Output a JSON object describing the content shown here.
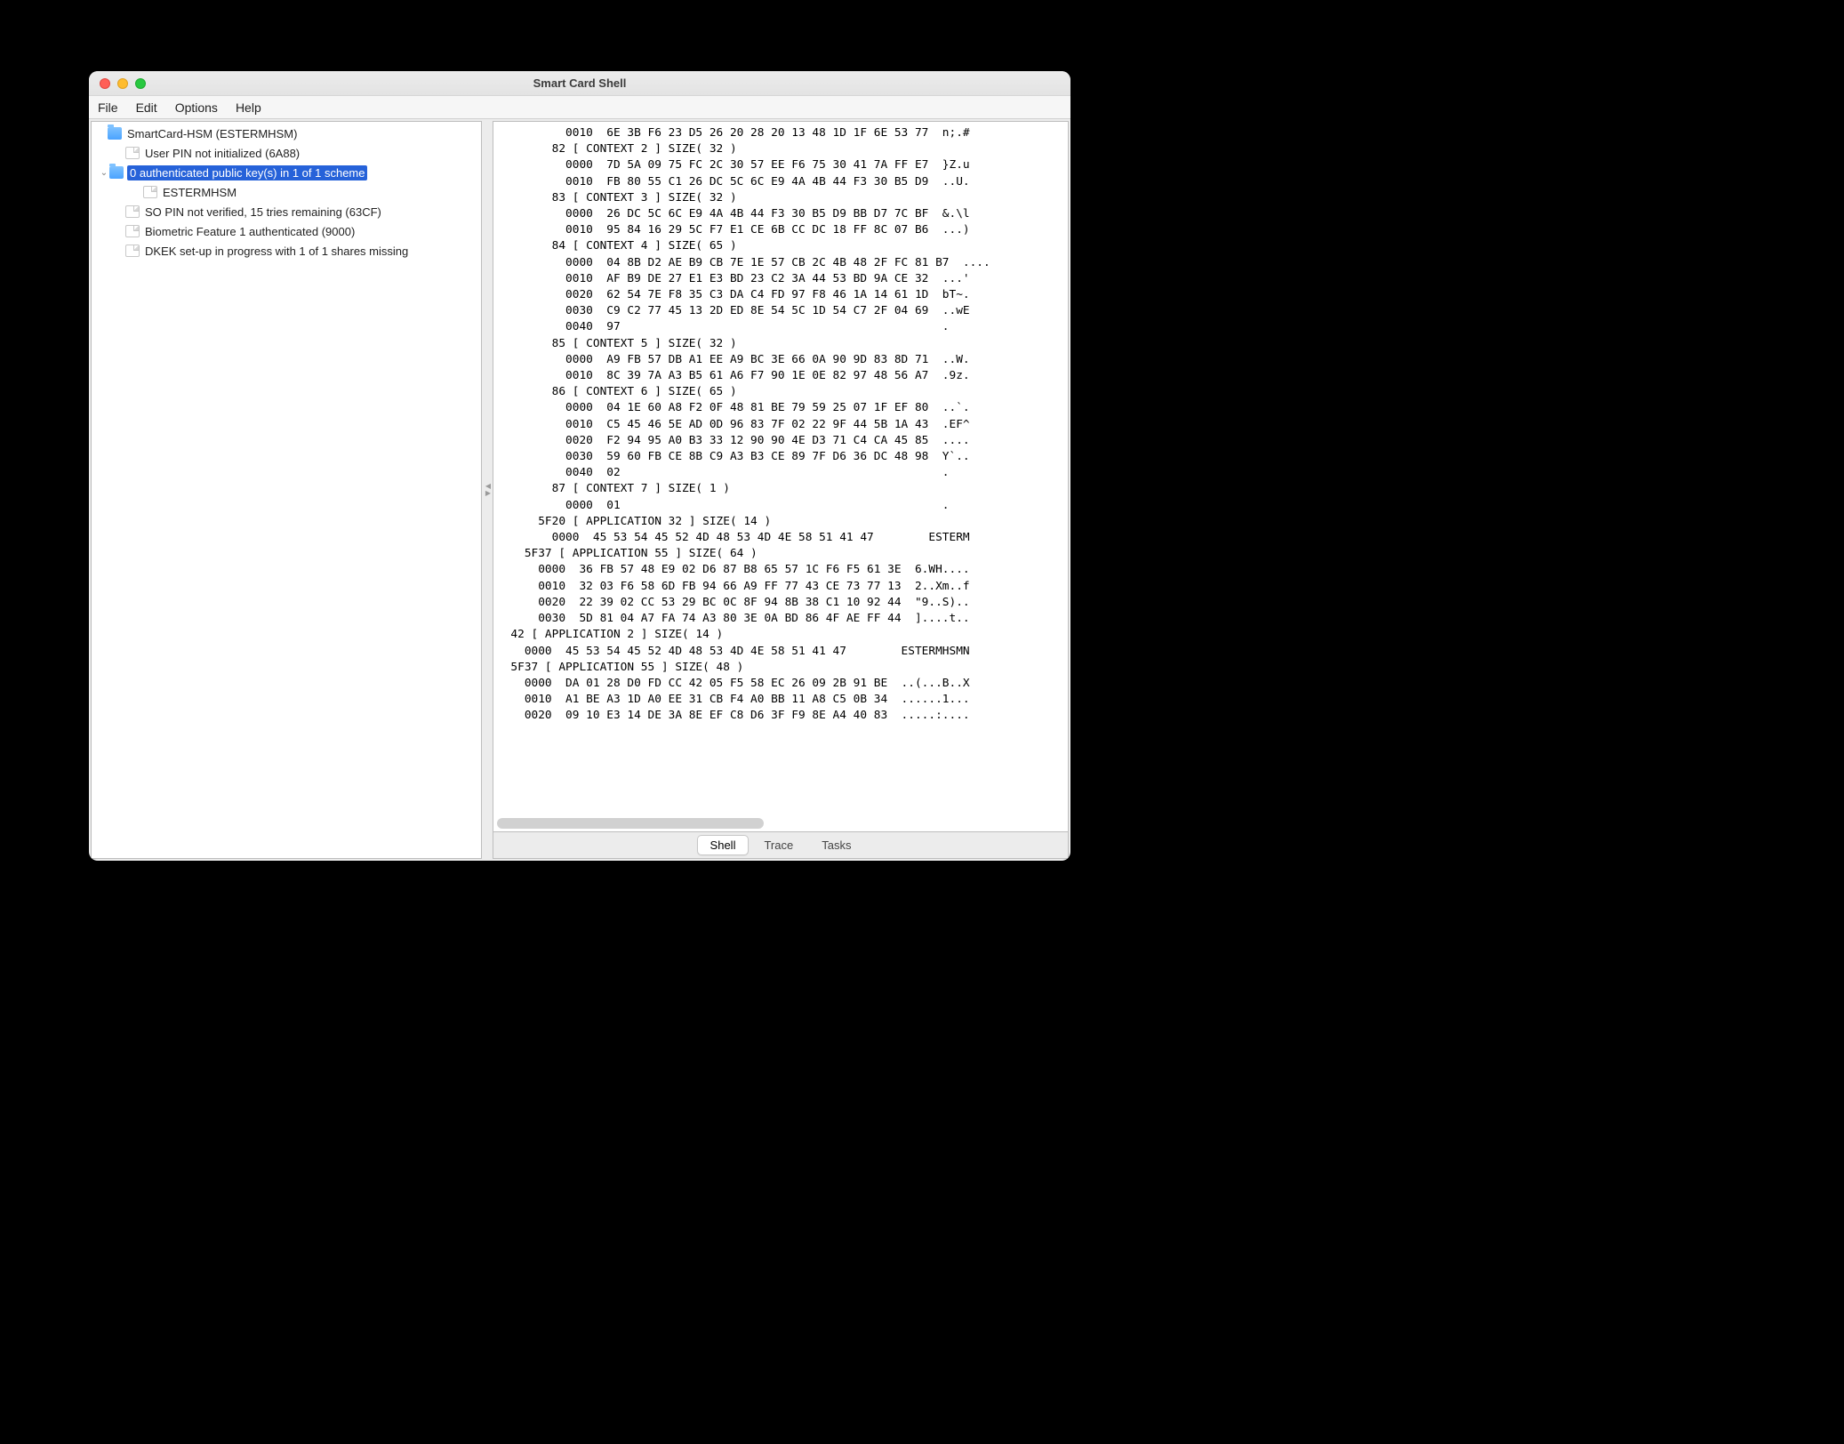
{
  "window": {
    "title": "Smart Card Shell"
  },
  "menu": {
    "items": [
      "File",
      "Edit",
      "Options",
      "Help"
    ]
  },
  "tree": {
    "root": {
      "label": "SmartCard-HSM (ESTERMHSM)",
      "children": [
        {
          "label": "User PIN not initialized (6A88)",
          "type": "file"
        },
        {
          "label": "0 authenticated public key(s) in 1 of 1 scheme",
          "type": "folder",
          "selected": true,
          "expanded": true,
          "children": [
            {
              "label": "ESTERMHSM",
              "type": "file"
            }
          ]
        },
        {
          "label": "SO PIN not verified, 15 tries remaining (63CF)",
          "type": "file"
        },
        {
          "label": "Biometric Feature 1 authenticated (9000)",
          "type": "file"
        },
        {
          "label": "DKEK set-up in progress with 1 of 1 shares missing",
          "type": "file"
        }
      ]
    }
  },
  "output_lines": [
    "          0010  6E 3B F6 23 D5 26 20 28 20 13 48 1D 1F 6E 53 77  n;.#",
    "        82 [ CONTEXT 2 ] SIZE( 32 )",
    "          0000  7D 5A 09 75 FC 2C 30 57 EE F6 75 30 41 7A FF E7  }Z.u",
    "          0010  FB 80 55 C1 26 DC 5C 6C E9 4A 4B 44 F3 30 B5 D9  ..U.",
    "        83 [ CONTEXT 3 ] SIZE( 32 )",
    "          0000  26 DC 5C 6C E9 4A 4B 44 F3 30 B5 D9 BB D7 7C BF  &.\\l",
    "          0010  95 84 16 29 5C F7 E1 CE 6B CC DC 18 FF 8C 07 B6  ...)",
    "        84 [ CONTEXT 4 ] SIZE( 65 )",
    "          0000  04 8B D2 AE B9 CB 7E 1E 57 CB 2C 4B 48 2F FC 81 B7  ....",
    "          0010  AF B9 DE 27 E1 E3 BD 23 C2 3A 44 53 BD 9A CE 32  ...'",
    "          0020  62 54 7E F8 35 C3 DA C4 FD 97 F8 46 1A 14 61 1D  bT~.",
    "          0030  C9 C2 77 45 13 2D ED 8E 54 5C 1D 54 C7 2F 04 69  ..wE",
    "          0040  97                                               .",
    "        85 [ CONTEXT 5 ] SIZE( 32 )",
    "          0000  A9 FB 57 DB A1 EE A9 BC 3E 66 0A 90 9D 83 8D 71  ..W.",
    "          0010  8C 39 7A A3 B5 61 A6 F7 90 1E 0E 82 97 48 56 A7  .9z.",
    "        86 [ CONTEXT 6 ] SIZE( 65 )",
    "          0000  04 1E 60 A8 F2 0F 48 81 BE 79 59 25 07 1F EF 80  ..`.",
    "          0010  C5 45 46 5E AD 0D 96 83 7F 02 22 9F 44 5B 1A 43  .EF^",
    "          0020  F2 94 95 A0 B3 33 12 90 90 4E D3 71 C4 CA 45 85  ....",
    "          0030  59 60 FB CE 8B C9 A3 B3 CE 89 7F D6 36 DC 48 98  Y`..",
    "          0040  02                                               .",
    "        87 [ CONTEXT 7 ] SIZE( 1 )",
    "          0000  01                                               .",
    "      5F20 [ APPLICATION 32 ] SIZE( 14 )",
    "        0000  45 53 54 45 52 4D 48 53 4D 4E 58 51 41 47        ESTERM",
    "    5F37 [ APPLICATION 55 ] SIZE( 64 )",
    "      0000  36 FB 57 48 E9 02 D6 87 B8 65 57 1C F6 F5 61 3E  6.WH....",
    "      0010  32 03 F6 58 6D FB 94 66 A9 FF 77 43 CE 73 77 13  2..Xm..f",
    "      0020  22 39 02 CC 53 29 BC 0C 8F 94 8B 38 C1 10 92 44  \"9..S)..",
    "      0030  5D 81 04 A7 FA 74 A3 80 3E 0A BD 86 4F AE FF 44  ]....t..",
    "  42 [ APPLICATION 2 ] SIZE( 14 )",
    "    0000  45 53 54 45 52 4D 48 53 4D 4E 58 51 41 47        ESTERMHSMN",
    "  5F37 [ APPLICATION 55 ] SIZE( 48 )",
    "    0000  DA 01 28 D0 FD CC 42 05 F5 58 EC 26 09 2B 91 BE  ..(...B..X",
    "    0010  A1 BE A3 1D A0 EE 31 CB F4 A0 BB 11 A8 C5 0B 34  ......1...",
    "    0020  09 10 E3 14 DE 3A 8E EF C8 D6 3F F9 8E A4 40 83  .....:...."
  ],
  "tabs": {
    "items": [
      "Shell",
      "Trace",
      "Tasks"
    ],
    "active": 0
  }
}
